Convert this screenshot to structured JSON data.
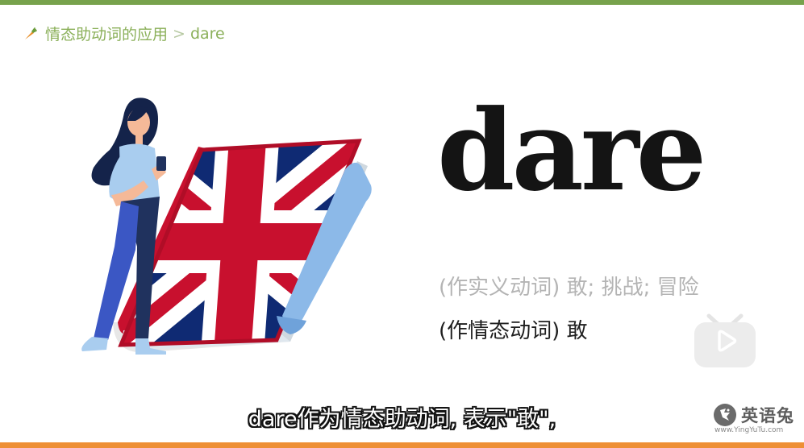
{
  "breadcrumb": {
    "icon": "carrot-icon",
    "section": "情态助动词的应用",
    "separator": ">",
    "current": "dare"
  },
  "word": "dare",
  "meanings": [
    "(作实义动词) 敢; 挑战; 冒险",
    "(作情态动词) 敢"
  ],
  "subtitle": "dare作为情态助动词, 表示\"敢\",",
  "logo": {
    "name": "英语兔",
    "url": "www.YingYuTu.com"
  },
  "play_button": {
    "icon": "play-icon"
  },
  "colors": {
    "top_bar": "#77a24c",
    "bottom_bar": "#ee8f35",
    "breadcrumb_text": "#8bb05a",
    "word": "#141414",
    "meaning_muted": "#b4b4b4",
    "meaning_dark": "#1e1e1e"
  }
}
